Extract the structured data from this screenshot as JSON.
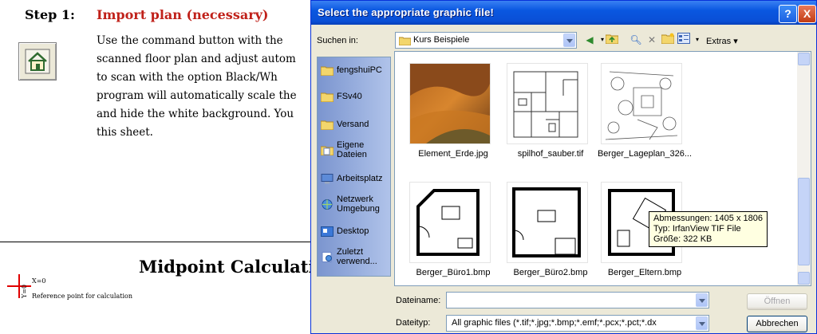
{
  "document": {
    "step_label": "Step 1:",
    "step_title": "Import plan (necessary)",
    "body_lines": [
      "Use the command button with the",
      "scanned floor plan and adjust autom",
      "to scan with the option Black/Wh",
      "program will automatically scale the",
      "and hide the white background. You",
      "this sheet."
    ],
    "home_button_icon": "house-icon",
    "midpoint_title": "Midpoint Calculati",
    "x_label": "X=0",
    "y_label": "Y=0",
    "reference_text": "Reference point for calculation",
    "accent_color": "#c0211a"
  },
  "dialog": {
    "title": "Select the appropriate graphic file!",
    "help_label": "?",
    "close_label": "X",
    "look_in_label": "Suchen in:",
    "look_in_value": "Kurs Beispiele",
    "extras_label": "Extras",
    "places": [
      {
        "label": "fengshuiPC",
        "icon": "folder-icon"
      },
      {
        "label": "FSv40",
        "icon": "folder-icon"
      },
      {
        "label": "Versand",
        "icon": "folder-icon"
      },
      {
        "label": "Eigene Dateien",
        "icon": "documents-icon"
      },
      {
        "label": "Arbeitsplatz",
        "icon": "computer-icon"
      },
      {
        "label": "Netzwerk Umgebung",
        "icon": "network-icon"
      },
      {
        "label": "Desktop",
        "icon": "desktop-icon"
      },
      {
        "label": "Zuletzt verwend...",
        "icon": "recent-icon"
      }
    ],
    "files": [
      {
        "name": "Element_Erde.jpg"
      },
      {
        "name": "spilhof_sauber.tif"
      },
      {
        "name": "Berger_Lageplan_326..."
      },
      {
        "name": "Berger_Büro1.bmp"
      },
      {
        "name": "Berger_Büro2.bmp"
      },
      {
        "name": "Berger_Eltern.bmp"
      }
    ],
    "tooltip": {
      "line1": "Abmessungen: 1405 x 1806",
      "line2": "Typ: IrfanView TIF File",
      "line3": "Größe: 322 KB"
    },
    "filename_label": "Dateiname:",
    "filename_value": "",
    "filetype_label": "Dateityp:",
    "filetype_value": "All graphic files (*.tif;*.jpg;*.bmp;*.emf;*.pcx;*.pct;*.dx",
    "open_label": "Öffnen",
    "cancel_label": "Abbrechen",
    "title_color": "#0a57e0"
  }
}
